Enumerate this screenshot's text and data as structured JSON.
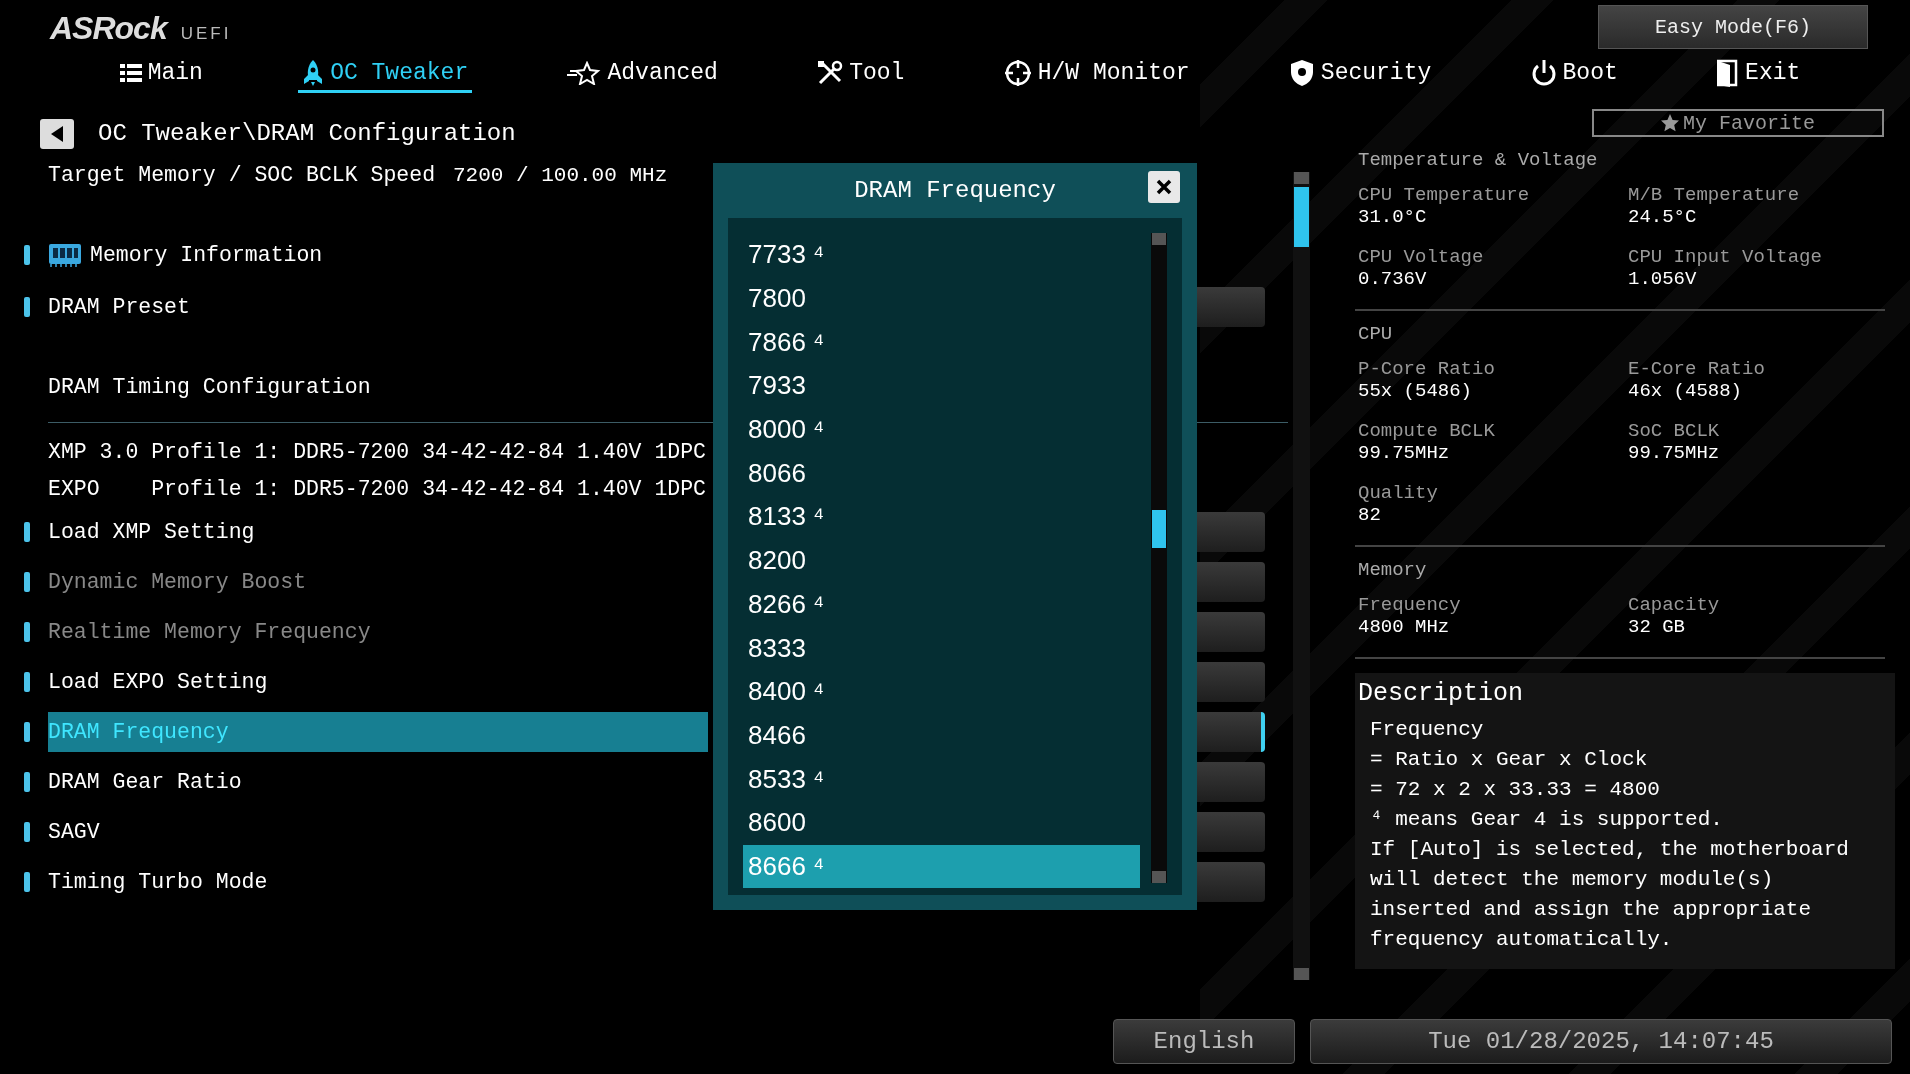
{
  "header": {
    "logo": "ASRock",
    "logo_suffix": "UEFI",
    "easy_mode": "Easy Mode(F6)",
    "tabs": [
      {
        "label": "Main",
        "selected": false
      },
      {
        "label": "OC Tweaker",
        "selected": true
      },
      {
        "label": "Advanced",
        "selected": false
      },
      {
        "label": "Tool",
        "selected": false
      },
      {
        "label": "H/W Monitor",
        "selected": false
      },
      {
        "label": "Security",
        "selected": false
      },
      {
        "label": "Boot",
        "selected": false
      },
      {
        "label": "Exit",
        "selected": false
      }
    ]
  },
  "breadcrumb": "OC Tweaker\\DRAM Configuration",
  "favorite": "My Favorite",
  "target": {
    "label": "Target Memory / SOC BCLK Speed",
    "value": "7200 / 100.00 MHz"
  },
  "menu": {
    "items": [
      {
        "kind": "submenu",
        "label": "Memory Information",
        "selected": false,
        "disabled": false
      },
      {
        "kind": "option",
        "label": "DRAM Preset",
        "selected": false,
        "disabled": false
      },
      {
        "kind": "heading",
        "label": "DRAM Timing Configuration",
        "selected": false,
        "disabled": false
      },
      {
        "kind": "info",
        "label": "XMP 3.0 Profile 1: DDR5-7200 34-42-42-84 1.40V 1DPC",
        "selected": false,
        "disabled": false
      },
      {
        "kind": "info",
        "label": "EXPO    Profile 1: DDR5-7200 34-42-42-84 1.40V 1DPC",
        "selected": false,
        "disabled": false
      },
      {
        "kind": "option",
        "label": "Load XMP Setting",
        "selected": false,
        "disabled": false
      },
      {
        "kind": "option",
        "label": "Dynamic Memory Boost",
        "selected": false,
        "disabled": true
      },
      {
        "kind": "option",
        "label": "Realtime Memory Frequency",
        "selected": false,
        "disabled": true
      },
      {
        "kind": "option",
        "label": "Load EXPO Setting",
        "selected": false,
        "disabled": false
      },
      {
        "kind": "option",
        "label": "DRAM Frequency",
        "selected": true,
        "disabled": false
      },
      {
        "kind": "option",
        "label": "DRAM Gear Ratio",
        "selected": false,
        "disabled": false
      },
      {
        "kind": "option",
        "label": "SAGV",
        "selected": false,
        "disabled": false
      },
      {
        "kind": "option",
        "label": "Timing Turbo Mode",
        "selected": false,
        "disabled": false
      }
    ]
  },
  "dialog": {
    "title": "DRAM Frequency",
    "options": [
      {
        "label": "7733 ⁴",
        "selected": false
      },
      {
        "label": "7800",
        "selected": false
      },
      {
        "label": "7866 ⁴",
        "selected": false
      },
      {
        "label": "7933",
        "selected": false
      },
      {
        "label": "8000 ⁴",
        "selected": false
      },
      {
        "label": "8066",
        "selected": false
      },
      {
        "label": "8133 ⁴",
        "selected": false
      },
      {
        "label": "8200",
        "selected": false
      },
      {
        "label": "8266 ⁴",
        "selected": false
      },
      {
        "label": "8333",
        "selected": false
      },
      {
        "label": "8400 ⁴",
        "selected": false
      },
      {
        "label": "8466",
        "selected": false
      },
      {
        "label": "8533 ⁴",
        "selected": false
      },
      {
        "label": "8600",
        "selected": false
      },
      {
        "label": "8666 ⁴",
        "selected": true
      }
    ]
  },
  "info": {
    "sections": [
      {
        "title": "Temperature & Voltage",
        "fields": [
          {
            "label": "CPU Temperature",
            "value": "31.0°C"
          },
          {
            "label": "M/B Temperature",
            "value": "24.5°C"
          },
          {
            "label": "CPU Voltage",
            "value": "0.736V"
          },
          {
            "label": "CPU Input Voltage",
            "value": "1.056V"
          }
        ]
      },
      {
        "title": "CPU",
        "fields": [
          {
            "label": "P-Core Ratio",
            "value": "55x (5486)"
          },
          {
            "label": "E-Core Ratio",
            "value": "46x (4588)"
          },
          {
            "label": "Compute BCLK",
            "value": "99.75MHz"
          },
          {
            "label": "SoC BCLK",
            "value": "99.75MHz"
          },
          {
            "label": "Quality",
            "value": "82"
          }
        ]
      },
      {
        "title": "Memory",
        "fields": [
          {
            "label": "Frequency",
            "value": "4800 MHz"
          },
          {
            "label": "Capacity",
            "value": "32 GB"
          }
        ]
      }
    ]
  },
  "description": {
    "title": "Description",
    "lines": [
      "Frequency",
      "= Ratio x Gear x Clock",
      "= 72 x 2 x 33.33 = 4800",
      "⁴ means Gear 4 is supported.",
      "If [Auto] is selected, the motherboard",
      "will detect the memory module(s)",
      "inserted and assign the appropriate",
      "frequency automatically."
    ]
  },
  "footer": {
    "language": "English",
    "datetime": "Tue 01/28/2025, 14:07:45"
  }
}
